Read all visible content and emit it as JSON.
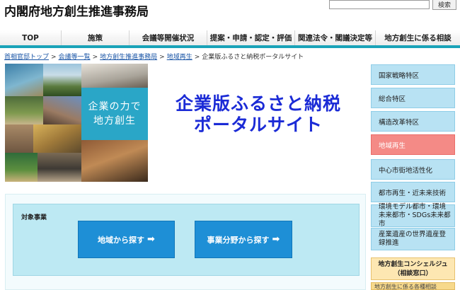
{
  "header": {
    "site_title": "内閣府地方創生推進事務局",
    "search_placeholder": "",
    "search_button": "検索"
  },
  "nav": {
    "items": [
      {
        "label": "TOP"
      },
      {
        "label": "施策"
      },
      {
        "label": "会議等開催状況"
      },
      {
        "label": "提案・申請・認定・評価"
      },
      {
        "label": "関連法令・閣議決定等"
      },
      {
        "label": "地方創生に係る相談"
      }
    ]
  },
  "breadcrumb": {
    "items": [
      {
        "label": "首相官邸トップ"
      },
      {
        "label": "会議等一覧"
      },
      {
        "label": "地方創生推進事務局"
      },
      {
        "label": "地域再生"
      },
      {
        "label": "企業版ふるさと納税ポータルサイト"
      }
    ],
    "separator": ">"
  },
  "banner": {
    "caption_line1": "企業の力で",
    "caption_line2": "地方創生",
    "title_line1": "企業版ふるさと納税",
    "title_line2": "ポータルサイト"
  },
  "search_panel": {
    "label": "対象事業",
    "by_region": "地域から探す",
    "by_field": "事業分野から探す",
    "arrow": "➡"
  },
  "sidebar": {
    "items": [
      {
        "label": "国家戦略特区"
      },
      {
        "label": "総合特区"
      },
      {
        "label": "構造改革特区"
      },
      {
        "label": "地域再生"
      },
      {
        "label": "中心市街地活性化"
      },
      {
        "label": "都市再生・近未来技術"
      },
      {
        "label": "環境モデル都市・環境未来都市・SDGs未来都市"
      },
      {
        "label": "産業遺産の世界遺産登録推進"
      }
    ],
    "consult_line1": "地方創生コンシェルジュ",
    "consult_line2": "（相談窓口）",
    "bottom_label": "地方創生に係る各種相談"
  },
  "colors": {
    "nav_accent": "#1aa3b8",
    "banner_title": "#1b2bd6",
    "caption_box": "#2aa6c7",
    "button_blue": "#1e8fd6",
    "panel_bg": "#bde9f3",
    "sidebar_bg": "#b8e2f3",
    "sidebar_active": "#f48a86",
    "consult_bg": "#fde7b2"
  }
}
